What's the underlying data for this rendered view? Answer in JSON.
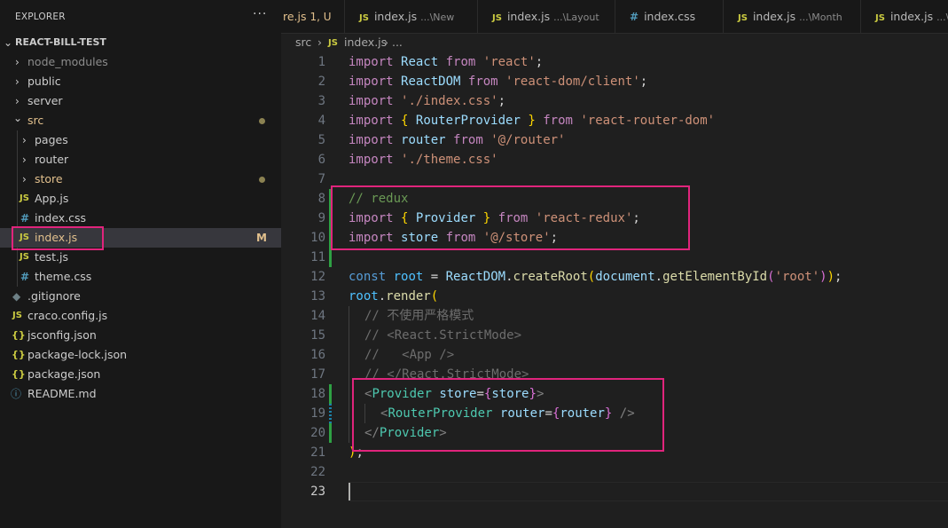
{
  "explorer": {
    "title": "EXPLORER",
    "more": "···",
    "root": "REACT-BILL-TEST",
    "items": [
      {
        "label": "node_modules",
        "type": "folder"
      },
      {
        "label": "public",
        "type": "folder"
      },
      {
        "label": "server",
        "type": "folder"
      },
      {
        "label": "src",
        "type": "folder-open"
      },
      {
        "label": "pages",
        "type": "folder"
      },
      {
        "label": "router",
        "type": "folder"
      },
      {
        "label": "store",
        "type": "folder"
      },
      {
        "label": "App.js",
        "type": "js"
      },
      {
        "label": "index.css",
        "type": "css"
      },
      {
        "label": "index.js",
        "type": "js",
        "badge": "M"
      },
      {
        "label": "test.js",
        "type": "js"
      },
      {
        "label": "theme.css",
        "type": "css"
      },
      {
        "label": ".gitignore",
        "type": "git"
      },
      {
        "label": "craco.config.js",
        "type": "js"
      },
      {
        "label": "jsconfig.json",
        "type": "json"
      },
      {
        "label": "package-lock.json",
        "type": "json"
      },
      {
        "label": "package.json",
        "type": "json"
      },
      {
        "label": "README.md",
        "type": "info"
      }
    ]
  },
  "icons": {
    "js": "JS",
    "css": "#",
    "json": "{}",
    "info": "ⓘ",
    "git": "◆",
    "chevron_right": "›",
    "chevron_down": "⌄"
  },
  "tabs": [
    {
      "name": "re.js",
      "desc": "1, U"
    },
    {
      "name": "index.js",
      "desc": "...\\New"
    },
    {
      "name": "index.js",
      "desc": "...\\Layout"
    },
    {
      "name": "index.css",
      "desc": ""
    },
    {
      "name": "index.js",
      "desc": "...\\Month"
    },
    {
      "name": "index.js",
      "desc": "...\\"
    }
  ],
  "breadcrumb": {
    "folder": "src",
    "sep": "›",
    "file": "index.js",
    "tail": "›  ..."
  },
  "editor": {
    "line_numbers": [
      "1",
      "2",
      "3",
      "4",
      "5",
      "6",
      "7",
      "8",
      "9",
      "10",
      "11",
      "12",
      "13",
      "14",
      "15",
      "16",
      "17",
      "18",
      "19",
      "20",
      "21",
      "22",
      "23"
    ],
    "lines": {
      "l1": [
        "import",
        "React",
        "from",
        "'react'",
        ";"
      ],
      "l2": [
        "import",
        "ReactDOM",
        "from",
        "'react-dom/client'",
        ";"
      ],
      "l3": [
        "import",
        "'./index.css'",
        ";"
      ],
      "l4": [
        "import",
        "{",
        "RouterProvider",
        "}",
        "from",
        "'react-router-dom'"
      ],
      "l5": [
        "import",
        "router",
        "from",
        "'@/router'"
      ],
      "l6": [
        "import",
        "'./theme.css'"
      ],
      "l8": "// redux",
      "l9": [
        "import",
        "{",
        "Provider",
        "}",
        "from",
        "'react-redux'",
        ";"
      ],
      "l10": [
        "import",
        "store",
        "from",
        "'@/store'",
        ";"
      ],
      "l12": [
        "const",
        "root",
        "=",
        "ReactDOM",
        ".",
        "createRoot",
        "(",
        "document",
        ".",
        "getElementById",
        "(",
        "'root'",
        ")",
        ")",
        ";"
      ],
      "l13": [
        "root",
        ".",
        "render",
        "("
      ],
      "l14": "// 不使用严格模式",
      "l15": "// <React.StrictMode>",
      "l16": "//   <App />",
      "l17": "// </React.StrictMode>",
      "l18": [
        "<",
        "Provider",
        "store",
        "=",
        "{",
        "store",
        "}",
        ">"
      ],
      "l19": [
        "<",
        "RouterProvider",
        "router",
        "=",
        "{",
        "router",
        "}",
        " />"
      ],
      "l20": [
        "</",
        "Provider",
        ">"
      ],
      "l21": [
        ")",
        ";"
      ]
    }
  }
}
